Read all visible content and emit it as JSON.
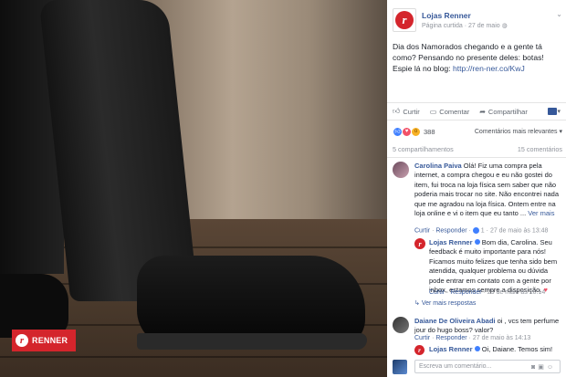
{
  "photo": {
    "logo_text": "RENNER",
    "logo_mark": "r"
  },
  "post": {
    "page_name": "Lojas Renner",
    "meta_liked": "Página curtida",
    "meta_sep": "·",
    "meta_date": "27 de maio",
    "meta_icon": "globe-icon",
    "text_line": "Dia dos Namorados chegando e a gente tá como? Pensando no presente deles: botas! Espie lá no blog: ",
    "link": "http://ren-ner.co/KwJ"
  },
  "actions": {
    "like": "Curtir",
    "comment": "Comentar",
    "share": "Compartilhar"
  },
  "reactions": {
    "count": "388",
    "sort_label": "Comentários mais relevantes",
    "icons": [
      "like-icon",
      "love-icon",
      "wow-icon"
    ]
  },
  "counts": {
    "shares": "5 compartilhamentos",
    "comments": "15 comentários"
  },
  "comments": [
    {
      "author": "Carolina Paiva",
      "text": "Olá! Fiz uma compra pela internet, a compra chegou e eu não gostei do item, fui troca na loja física sem saber que não poderia mais trocar no site. Não encontrei nada que me agradou na loja física. Ontem entre na loja online e vi o item que eu tanto ...",
      "more": "Ver mais",
      "like": "Curtir",
      "reply": "Responder",
      "reactions": "1",
      "date": "27 de maio às 13:48"
    },
    {
      "author": "Lojas Renner",
      "text": "Bom dia, Carolina. Seu feedback é muito importante para nós! Ficamos muito felizes que tenha sido bem atendida, qualquer problema ou dúvida pode entrar em contato com a gente por inbox, estamos sempre a disposição.",
      "like": "Curtir",
      "reply": "Responder",
      "date": "29 de maio às 10:14",
      "more_replies": "Ver mais respostas"
    },
    {
      "author": "Daiane De Oliveira Abadi",
      "text": "oi , vcs tem perfume jour do hugo boss? valor?",
      "like": "Curtir",
      "reply": "Responder",
      "date": "27 de maio às 14:13"
    },
    {
      "author": "Lojas Renner",
      "text": "Oi, Daiane. Temos sim!"
    }
  ],
  "composer": {
    "placeholder": "Escreva um comentário..."
  },
  "colors": {
    "brand_red": "#d4252c",
    "link_blue": "#365899",
    "muted": "#90949c"
  }
}
